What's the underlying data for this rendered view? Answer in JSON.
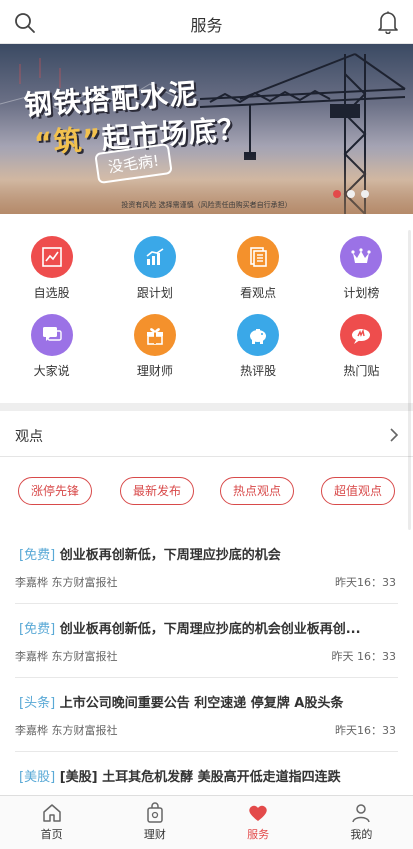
{
  "header": {
    "title": "服务",
    "search_icon": "search-icon",
    "bell_icon": "bell-icon"
  },
  "banner": {
    "line1": "钢铁搭配水泥",
    "line2_quote": "“筑”",
    "line2_rest": "起市场底？",
    "stamp": "没毛病!",
    "disclaimer": "投资有风险  选择需谨慎（风险责任由购买者自行承担）",
    "slides": 3,
    "active_slide": 1,
    "active_dot_color": "#e34a4a"
  },
  "grid": [
    {
      "label": "自选股",
      "icon": "chart-line-icon",
      "color": "#ee4d4d"
    },
    {
      "label": "跟计划",
      "icon": "bar-chart-icon",
      "color": "#3aa8e8"
    },
    {
      "label": "看观点",
      "icon": "document-icon",
      "color": "#f4912c"
    },
    {
      "label": "计划榜",
      "icon": "crown-icon",
      "color": "#9b72e6"
    },
    {
      "label": "大家说",
      "icon": "chat-icon",
      "color": "#9b72e6"
    },
    {
      "label": "理财师",
      "icon": "gift-icon",
      "color": "#f4912c"
    },
    {
      "label": "热评股",
      "icon": "piggy-bank-icon",
      "color": "#3aa8e8"
    },
    {
      "label": "热门贴",
      "icon": "hot-post-icon",
      "color": "#ee4d4d"
    }
  ],
  "section": {
    "title": "观点",
    "arrow_icon": "chevron-right-icon"
  },
  "tags": [
    "涨停先锋",
    "最新发布",
    "热点观点",
    "超值观点"
  ],
  "news": [
    {
      "tag": "[免费]",
      "title": "创业板再创新低，下周理应抄底的机会",
      "author": "李嘉桦 东方财富报社",
      "time": "昨天16：33"
    },
    {
      "tag": "[免费]",
      "title": "创业板再创新低，下周理应抄底的机会创业板再创...",
      "author": "李嘉桦 东方财富报社",
      "time": "昨天 16：33"
    },
    {
      "tag": "[头条]",
      "title": "上市公司晚间重要公告 利空速递 停复牌 A股头条",
      "author": "李嘉桦 东方财富报社",
      "time": "昨天16：33"
    },
    {
      "tag": "[美股]",
      "title": "[美股] 土耳其危机发酵 美股高开低走道指四连跌",
      "author": "",
      "time": ""
    }
  ],
  "tabbar": [
    {
      "label": "首页",
      "icon": "home-icon",
      "active": false
    },
    {
      "label": "理财",
      "icon": "wallet-icon",
      "active": false
    },
    {
      "label": "服务",
      "icon": "heart-icon",
      "active": true
    },
    {
      "label": "我的",
      "icon": "user-icon",
      "active": false
    }
  ],
  "colors": {
    "accent": "#e34a4a",
    "tag_blue": "#5aa9d6"
  }
}
